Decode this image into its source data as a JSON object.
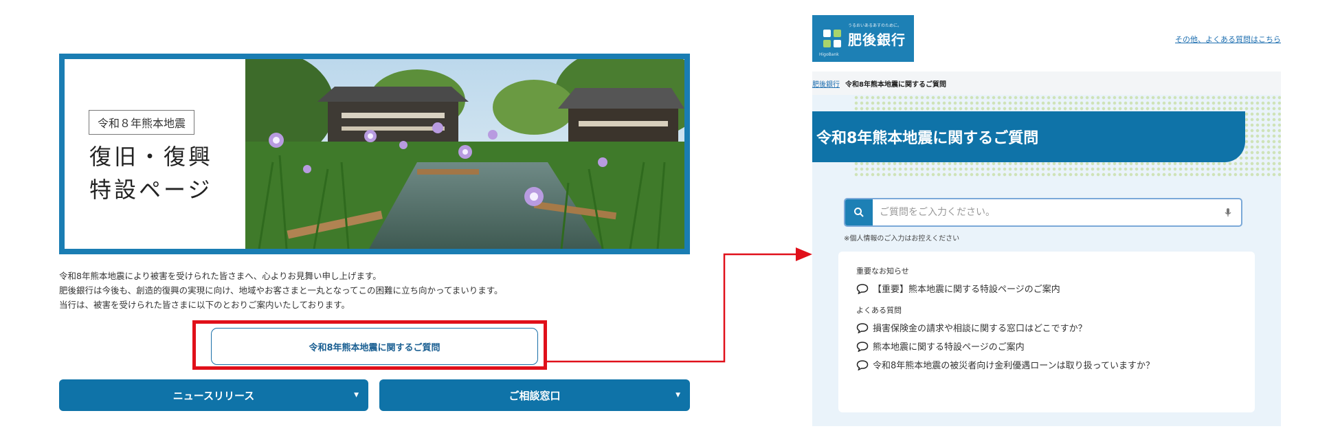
{
  "left": {
    "hero": {
      "badge": "令和８年熊本地震",
      "title_line1": "復旧・復興",
      "title_line2": "特設ページ"
    },
    "intro": [
      "令和8年熊本地震により被害を受けられた皆さまへ、心よりお見舞い申し上げます。",
      "肥後銀行は今後も、創造的復興の実現に向け、地域やお客さまと一丸となってこの困難に立ち向かってまいります。",
      "当行は、被害を受けられた皆さまに以下のとおりご案内いたしております。"
    ],
    "faq_button_label": "令和8年熊本地震に関するご質問",
    "news_button_label": "ニュースリリース",
    "consult_button_label": "ご相談窓口"
  },
  "right": {
    "logo": {
      "text": "肥後銀行",
      "tagline": "うるおいあるあすのために。",
      "sub": "HigoBank"
    },
    "header_link": "その他、よくある質問はこちら",
    "breadcrumb": {
      "home": "肥後銀行",
      "current": "令和8年熊本地震に関するご質問"
    },
    "page_title": "令和8年熊本地震に関するご質問",
    "search": {
      "placeholder": "ご質問をご入力ください。"
    },
    "privacy_note": "※個人情報のご入力はお控えください",
    "notice_heading": "重要なお知らせ",
    "notice_item": "【重要】熊本地震に関する特設ページのご案内",
    "faq_heading": "よくある質問",
    "faq_items": [
      "損害保険金の請求や相談に関する窓口はどこですか？",
      "熊本地震に関する特設ページのご案内",
      "令和8年熊本地震の被災者向け金利優遇ローンは取り扱っていますか？"
    ]
  },
  "colors": {
    "brand_blue": "#0f73a8",
    "highlight_red": "#e0101a",
    "panel_bg": "#eaf3fa"
  }
}
